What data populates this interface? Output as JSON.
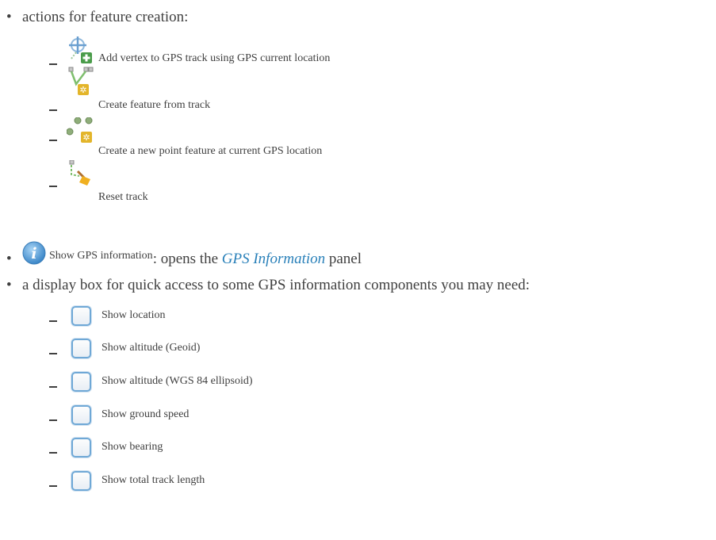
{
  "creation": {
    "bullet": "•",
    "heading": "actions for feature creation:",
    "items": [
      {
        "icon": "add-vertex-gps-icon",
        "label": "Add vertex to GPS track using GPS current location"
      },
      {
        "icon": "create-feature-from-track-icon",
        "label": "Create feature from track"
      },
      {
        "icon": "create-point-feature-icon",
        "label": "Create a new point feature at current GPS location"
      },
      {
        "icon": "reset-track-icon",
        "label": "Reset track"
      }
    ]
  },
  "gps_info": {
    "bullet": "•",
    "icon": "info-icon",
    "button_label": "Show GPS information",
    "text_before": ": opens the ",
    "link": "GPS Information",
    "text_after": " panel"
  },
  "display_box": {
    "bullet": "•",
    "heading": "a display box for quick access to some GPS information components you may need:",
    "items": [
      {
        "label": "Show location"
      },
      {
        "label": "Show altitude (Geoid)"
      },
      {
        "label": "Show altitude (WGS 84 ellipsoid)"
      },
      {
        "label": "Show ground speed"
      },
      {
        "label": "Show bearing"
      },
      {
        "label": "Show total track length"
      }
    ]
  }
}
